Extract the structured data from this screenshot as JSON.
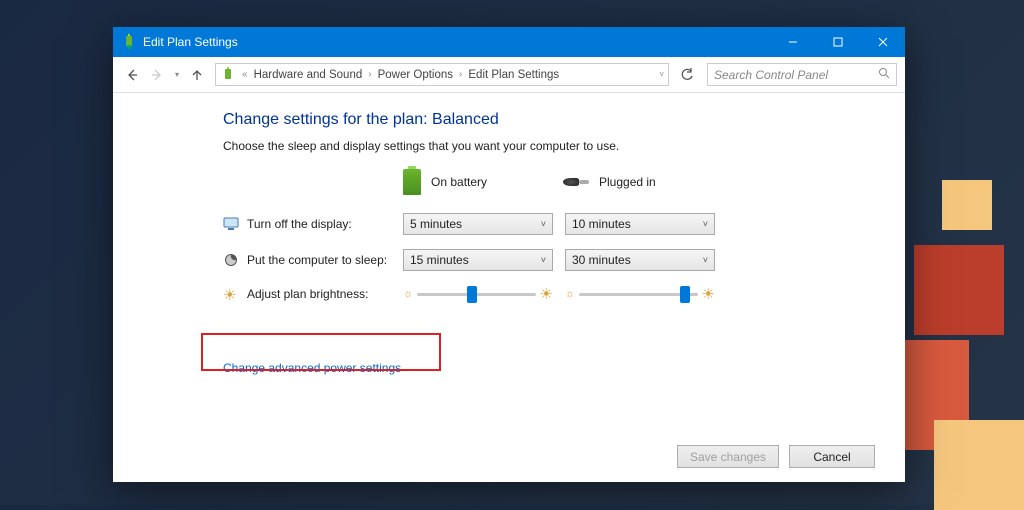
{
  "titlebar": {
    "title": "Edit Plan Settings"
  },
  "breadcrumb": {
    "seg1": "Hardware and Sound",
    "seg2": "Power Options",
    "seg3": "Edit Plan Settings"
  },
  "search": {
    "placeholder": "Search Control Panel"
  },
  "page": {
    "heading": "Change settings for the plan: Balanced",
    "subtext": "Choose the sleep and display settings that you want your computer to use.",
    "col_battery": "On battery",
    "col_plugged": "Plugged in",
    "rows": {
      "display_label": "Turn off the display:",
      "display_battery": "5 minutes",
      "display_plugged": "10 minutes",
      "sleep_label": "Put the computer to sleep:",
      "sleep_battery": "15 minutes",
      "sleep_plugged": "30 minutes",
      "brightness_label": "Adjust plan brightness:"
    },
    "brightness": {
      "battery_pct": 42,
      "plugged_pct": 85
    },
    "advanced_link": "Change advanced power settings",
    "buttons": {
      "save": "Save changes",
      "cancel": "Cancel"
    }
  }
}
